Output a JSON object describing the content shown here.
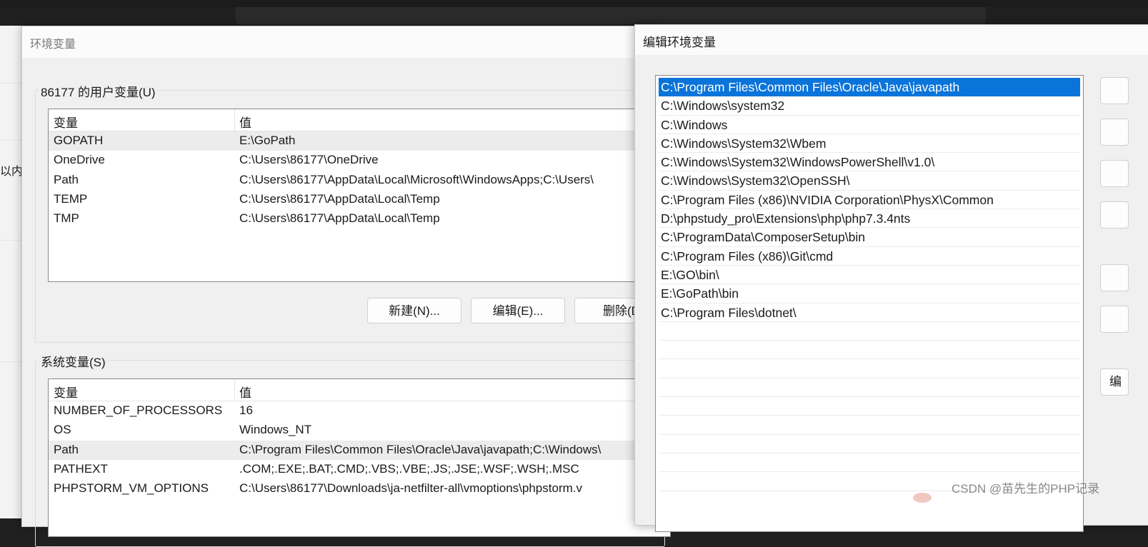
{
  "background_window": {
    "partial_text": "以内"
  },
  "env_dialog": {
    "title": "环境变量",
    "user_vars": {
      "label": "86177 的用户变量(U)",
      "col_var": "变量",
      "col_val": "值",
      "rows": [
        {
          "name": "GOPATH",
          "value": "E:\\GoPath",
          "selected": true
        },
        {
          "name": "OneDrive",
          "value": "C:\\Users\\86177\\OneDrive"
        },
        {
          "name": "Path",
          "value": "C:\\Users\\86177\\AppData\\Local\\Microsoft\\WindowsApps;C:\\Users\\"
        },
        {
          "name": "TEMP",
          "value": "C:\\Users\\86177\\AppData\\Local\\Temp"
        },
        {
          "name": "TMP",
          "value": "C:\\Users\\86177\\AppData\\Local\\Temp"
        }
      ],
      "buttons": {
        "new": "新建(N)...",
        "edit": "编辑(E)...",
        "delete": "删除(D"
      }
    },
    "system_vars": {
      "label": "系统变量(S)",
      "col_var": "变量",
      "col_val": "值",
      "rows": [
        {
          "name": "NUMBER_OF_PROCESSORS",
          "value": "16"
        },
        {
          "name": "OS",
          "value": "Windows_NT"
        },
        {
          "name": "Path",
          "value": "C:\\Program Files\\Common Files\\Oracle\\Java\\javapath;C:\\Windows\\",
          "selected": true
        },
        {
          "name": "PATHEXT",
          "value": ".COM;.EXE;.BAT;.CMD;.VBS;.VBE;.JS;.JSE;.WSF;.WSH;.MSC"
        },
        {
          "name": "PHPSTORM_VM_OPTIONS",
          "value": "C:\\Users\\86177\\Downloads\\ja-netfilter-all\\vmoptions\\phpstorm.v"
        }
      ]
    }
  },
  "edit_dialog": {
    "title": "编辑环境变量",
    "paths": [
      "C:\\Program Files\\Common Files\\Oracle\\Java\\javapath",
      "C:\\Windows\\system32",
      "C:\\Windows",
      "C:\\Windows\\System32\\Wbem",
      "C:\\Windows\\System32\\WindowsPowerShell\\v1.0\\",
      "C:\\Windows\\System32\\OpenSSH\\",
      "C:\\Program Files (x86)\\NVIDIA Corporation\\PhysX\\Common",
      "D:\\phpstudy_pro\\Extensions\\php\\php7.3.4nts",
      "C:\\ProgramData\\ComposerSetup\\bin",
      "C:\\Program Files (x86)\\Git\\cmd",
      "E:\\GO\\bin\\",
      "E:\\GoPath\\bin",
      "C:\\Program Files\\dotnet\\"
    ],
    "selected_index": 0,
    "empty_rows": 9,
    "partial_button_text": "编"
  },
  "watermark": "CSDN @苗先生的PHP记录"
}
